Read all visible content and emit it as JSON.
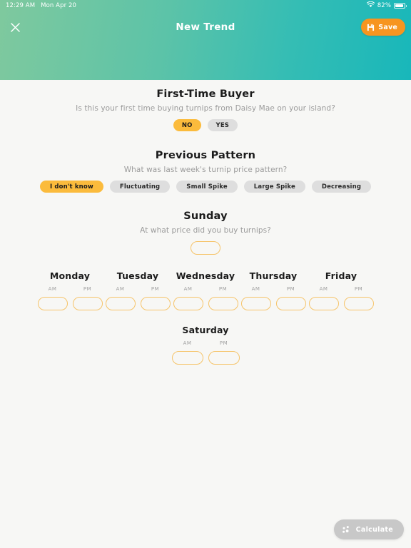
{
  "statusbar": {
    "time": "12:29 AM",
    "date": "Mon Apr 20",
    "wifi_icon": "wifi-icon",
    "battery_percent": "82%",
    "battery_icon": "battery-icon"
  },
  "navbar": {
    "close_icon": "close-icon",
    "title": "New Trend",
    "save_label": "Save",
    "save_icon": "save-disk-icon",
    "gradient_from": "#7FC99E",
    "gradient_to": "#18B7BA",
    "save_color": "#F79520"
  },
  "sections": {
    "first_time_buyer": {
      "title": "First-Time Buyer",
      "subtitle": "Is this your first time buying turnips from Daisy Mae on your island?",
      "options": [
        {
          "label": "NO",
          "selected": true
        },
        {
          "label": "YES",
          "selected": false
        }
      ]
    },
    "previous_pattern": {
      "title": "Previous Pattern",
      "subtitle": "What was last week's turnip price pattern?",
      "options": [
        {
          "label": "I don't know",
          "selected": true
        },
        {
          "label": "Fluctuating",
          "selected": false
        },
        {
          "label": "Small Spike",
          "selected": false
        },
        {
          "label": "Large Spike",
          "selected": false
        },
        {
          "label": "Decreasing",
          "selected": false
        }
      ]
    },
    "sunday": {
      "title": "Sunday",
      "subtitle": "At what price did you buy turnips?",
      "value": "",
      "placeholder": ""
    },
    "weekdays": [
      {
        "name": "Monday",
        "am": {
          "label": "AM",
          "value": ""
        },
        "pm": {
          "label": "PM",
          "value": ""
        }
      },
      {
        "name": "Tuesday",
        "am": {
          "label": "AM",
          "value": ""
        },
        "pm": {
          "label": "PM",
          "value": ""
        }
      },
      {
        "name": "Wednesday",
        "am": {
          "label": "AM",
          "value": ""
        },
        "pm": {
          "label": "PM",
          "value": ""
        }
      },
      {
        "name": "Thursday",
        "am": {
          "label": "AM",
          "value": ""
        },
        "pm": {
          "label": "PM",
          "value": ""
        }
      },
      {
        "name": "Friday",
        "am": {
          "label": "AM",
          "value": ""
        },
        "pm": {
          "label": "PM",
          "value": ""
        }
      }
    ],
    "saturday": {
      "name": "Saturday",
      "am": {
        "label": "AM",
        "value": ""
      },
      "pm": {
        "label": "PM",
        "value": ""
      }
    }
  },
  "calculate": {
    "label": "Calculate",
    "icon": "scatter-dots-icon",
    "enabled": false,
    "color": "#C8C8C8"
  },
  "theme": {
    "accent_orange": "#F79520",
    "accent_yellow": "#FBBB3C",
    "input_border": "#F6C46A",
    "chip_gray": "#DEDEDE",
    "page_bg": "#F7F7F5",
    "muted_text": "#9b9b9b"
  }
}
